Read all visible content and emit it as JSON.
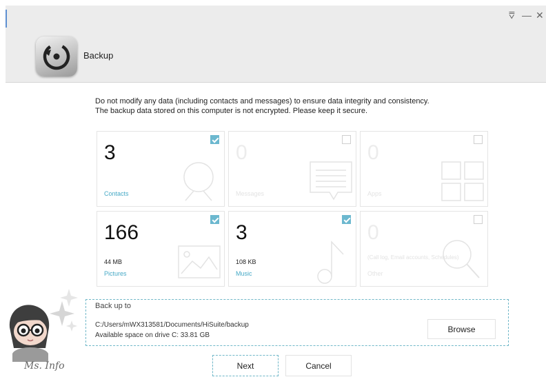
{
  "window": {
    "app_title": "Backup",
    "controls": [
      "⩢",
      "—",
      "✕"
    ]
  },
  "notice": {
    "line1": "Do not modify any data (including contacts and messages) to ensure data integrity and consistency.",
    "line2": "The backup data stored on this computer is not encrypted. Please keep it secure."
  },
  "cards": [
    {
      "label": "Contacts",
      "count": "3",
      "size": "",
      "checked": true,
      "icon": "contacts-icon"
    },
    {
      "label": "Messages",
      "count": "0",
      "size": "",
      "checked": false,
      "icon": "messages-icon"
    },
    {
      "label": "Apps",
      "count": "0",
      "size": "",
      "checked": false,
      "icon": "apps-icon"
    },
    {
      "label": "Pictures",
      "count": "166",
      "size": "44 MB",
      "checked": true,
      "icon": "pictures-icon"
    },
    {
      "label": "Music",
      "count": "3",
      "size": "108 KB",
      "checked": true,
      "icon": "music-icon"
    },
    {
      "label": "Other",
      "count": "0",
      "size": "",
      "subtext": "(Call log, Email accounts, Schedules)",
      "checked": false,
      "icon": "search-icon"
    }
  ],
  "backup": {
    "label": "Back up to",
    "path": "C:/Users/mWX313581/Documents/HiSuite/backup",
    "space": "Available space on drive C: 33.81 GB",
    "browse_label": "Browse"
  },
  "buttons": {
    "next": "Next",
    "cancel": "Cancel"
  },
  "watermark": "Ms. Info",
  "colors": {
    "accent": "#46a9c6",
    "checkbox": "#6cb8cf",
    "header_bg": "#ececec",
    "focus_border": "#6fb7c8"
  }
}
